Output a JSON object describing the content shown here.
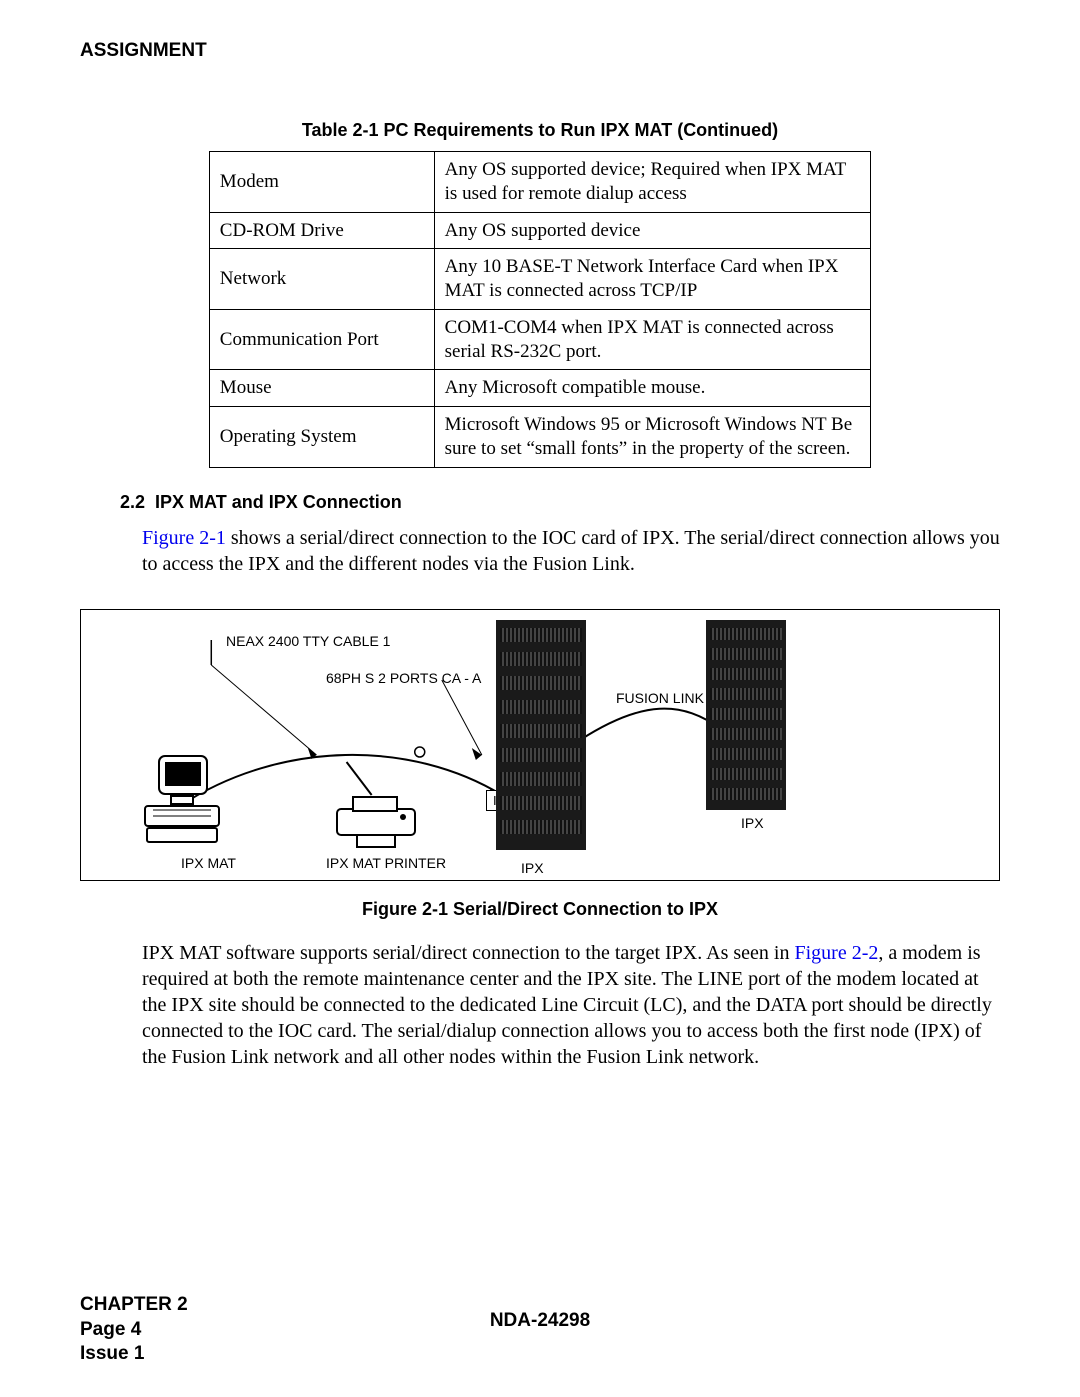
{
  "header": "ASSIGNMENT",
  "table": {
    "title": "Table 2-1 PC Requirements to Run IPX MAT (Continued)",
    "rows": [
      {
        "k": "Modem",
        "v": "Any OS supported device; Required when IPX MAT is used for remote dialup access"
      },
      {
        "k": "CD-ROM Drive",
        "v": "Any OS supported device"
      },
      {
        "k": "Network",
        "v": "Any 10 BASE-T Network Interface Card when IPX MAT is connected across TCP/IP"
      },
      {
        "k": "Communication Port",
        "v": "COM1-COM4 when IPX MAT is connected across serial RS-232C port."
      },
      {
        "k": "Mouse",
        "v": "Any Microsoft compatible mouse."
      },
      {
        "k": "Operating System",
        "v": "Microsoft Windows 95 or Microsoft Windows NT Be sure to set “small fonts” in the property of the screen."
      }
    ]
  },
  "section": {
    "num": "2.2",
    "title": "IPX MAT and IPX Connection"
  },
  "para1_pre": "Figure 2-1",
  "para1_rest": " shows a serial/direct connection to the IOC card of IPX. The serial/direct connection allows you to access the IPX and the different nodes via the Fusion Link.",
  "figure": {
    "caption": "Figure 2-1   Serial/Direct Connection to IPX",
    "labels": {
      "cable": "NEAX 2400 TTY CABLE   1",
      "ports": "68PH S 2 PORTS CA - A",
      "fusion": "FUSION LINK",
      "ioc": "IOC",
      "ipx_left": "IPX",
      "ipx_right": "IPX",
      "mat": "IPX MAT",
      "printer": "IPX MAT PRINTER"
    }
  },
  "para2_a": "IPX MAT software supports serial/direct connection to the target IPX. As seen in ",
  "para2_link": "Figure 2-2",
  "para2_b": ", a modem is required at both the remote maintenance center and the IPX site. The LINE port of the modem located at the IPX site should be connected to the dedicated Line Circuit (LC), and the DATA port should be directly connected to the IOC card. The serial/dialup connection allows you to access both the first node (IPX) of the Fusion Link network and all other nodes within the Fusion Link network.",
  "footer": {
    "chapter": "CHAPTER 2",
    "page": "Page 4",
    "issue": "Issue 1",
    "doc": "NDA-24298"
  }
}
